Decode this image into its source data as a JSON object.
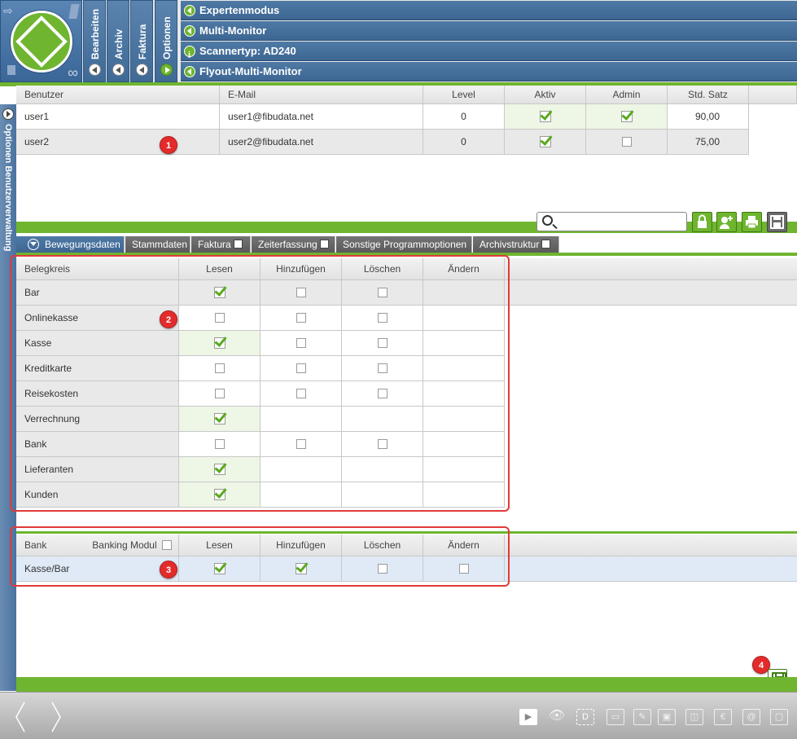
{
  "header": {
    "vtabs": [
      "Bearbeiten",
      "Archiv",
      "Faktura",
      "Optionen"
    ],
    "bars": [
      {
        "label": "Expertenmodus",
        "icon": "arrow-left-icon"
      },
      {
        "label": "Multi-Monitor",
        "icon": "arrow-left-icon"
      },
      {
        "label": "Scannertyp: AD240",
        "icon": "info-icon"
      },
      {
        "label": "Flyout-Multi-Monitor",
        "icon": "arrow-left-icon"
      }
    ]
  },
  "side": {
    "label": "Optionen  Benutzerverwaltung"
  },
  "users": {
    "columns": [
      "Benutzer",
      "E-Mail",
      "Level",
      "Aktiv",
      "Admin",
      "Std. Satz"
    ],
    "rows": [
      {
        "name": "user1",
        "email": "user1@fibudata.net",
        "level": "0",
        "aktiv": true,
        "admin": true,
        "satz": "90,00"
      },
      {
        "name": "user2",
        "email": "user2@fibudata.net",
        "level": "0",
        "aktiv": true,
        "admin": false,
        "satz": "75,00"
      }
    ]
  },
  "search": {
    "placeholder": ""
  },
  "tabs": [
    {
      "label": "Bewegungsdaten",
      "checkbox": false
    },
    {
      "label": "Stammdaten",
      "checkbox": false
    },
    {
      "label": "Faktura",
      "checkbox": true
    },
    {
      "label": "Zeiterfassung",
      "checkbox": true
    },
    {
      "label": "Sonstige Programmoptionen",
      "checkbox": false
    },
    {
      "label": "Archivstruktur",
      "checkbox": true
    }
  ],
  "belege": {
    "columns": [
      "Belegkreis",
      "Lesen",
      "Hinzufügen",
      "Löschen",
      "Ändern"
    ],
    "rows": [
      {
        "name": "Bar",
        "lesen": "checked",
        "hinzufuegen": "box",
        "loeschen": "box",
        "aendern": "none"
      },
      {
        "name": "Onlinekasse",
        "lesen": "box",
        "hinzufuegen": "box",
        "loeschen": "box",
        "aendern": "none"
      },
      {
        "name": "Kasse",
        "lesen": "checked",
        "hinzufuegen": "box",
        "loeschen": "box",
        "aendern": "none"
      },
      {
        "name": "Kreditkarte",
        "lesen": "box",
        "hinzufuegen": "box",
        "loeschen": "box",
        "aendern": "none"
      },
      {
        "name": "Reisekosten",
        "lesen": "box",
        "hinzufuegen": "box",
        "loeschen": "box",
        "aendern": "none"
      },
      {
        "name": "Verrechnung",
        "lesen": "checked",
        "hinzufuegen": "none",
        "loeschen": "none",
        "aendern": "none"
      },
      {
        "name": "Bank",
        "lesen": "box",
        "hinzufuegen": "box",
        "loeschen": "box",
        "aendern": "none"
      },
      {
        "name": "Lieferanten",
        "lesen": "checked",
        "hinzufuegen": "none",
        "loeschen": "none",
        "aendern": "none"
      },
      {
        "name": "Kunden",
        "lesen": "checked",
        "hinzufuegen": "none",
        "loeschen": "none",
        "aendern": "none"
      }
    ]
  },
  "bank": {
    "columns": [
      "Bank",
      "Banking Modul",
      "Lesen",
      "Hinzufügen",
      "Löschen",
      "Ändern"
    ],
    "rows": [
      {
        "name": "Kasse/Bar",
        "lesen": "checked",
        "hinzufuegen": "checked",
        "loeschen": "box",
        "aendern": "box"
      }
    ]
  },
  "markers": [
    "1",
    "2",
    "3",
    "4"
  ],
  "colors": {
    "accent": "#6fb530",
    "header_blue": "#3d6692",
    "highlight_red": "#e23a3a"
  }
}
